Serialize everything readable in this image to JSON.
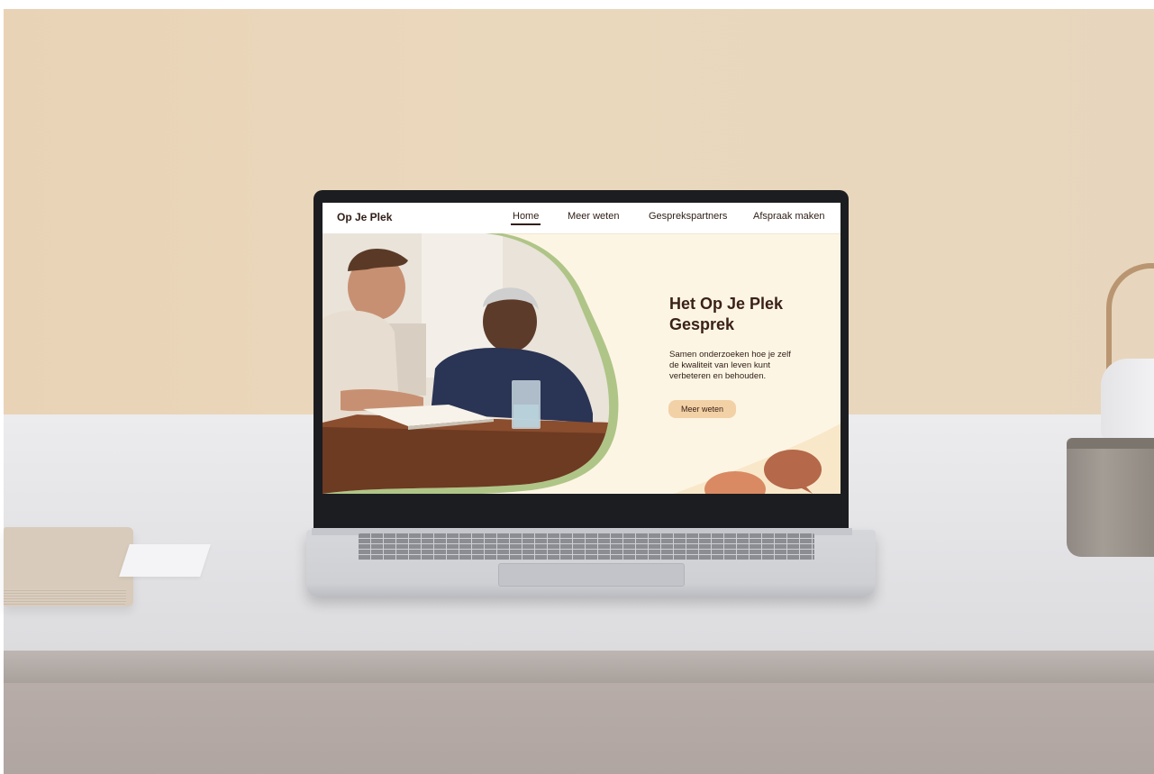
{
  "site": {
    "brand": "Op Je Plek",
    "nav": [
      {
        "label": "Home",
        "active": true
      },
      {
        "label": "Meer weten",
        "active": false
      },
      {
        "label": "Gesprekspartners",
        "active": false
      },
      {
        "label": "Afspraak maken",
        "active": false
      }
    ]
  },
  "hero": {
    "title_line1": "Het Op Je Plek",
    "title_line2": "Gesprek",
    "text_line1": "Samen onderzoeken hoe je zelf",
    "text_line2": "de kwaliteit van leven kunt",
    "text_line3": "verbeteren en behouden.",
    "button_label": "Meer weten",
    "photo_icon": "people-reading-photo"
  },
  "colors": {
    "accent_green": "#a6c07c",
    "button_bg": "#f3d1a6",
    "speech_bubble": "#b5684a",
    "speech_bubble_light": "#d98a62",
    "text_dark": "#2f1d16",
    "page_bg": "#fdf5e4"
  }
}
